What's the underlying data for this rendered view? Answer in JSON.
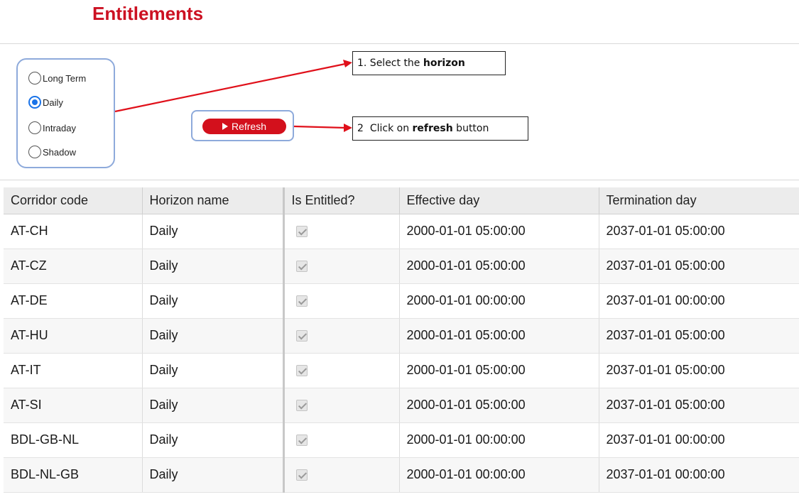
{
  "page": {
    "title": "Entitlements"
  },
  "horizon": {
    "options": [
      {
        "label": "Long Term",
        "selected": false
      },
      {
        "label": "Daily",
        "selected": true
      },
      {
        "label": "Intraday",
        "selected": false
      },
      {
        "label": "Shadow",
        "selected": false
      }
    ]
  },
  "refresh": {
    "label": "Refresh",
    "icon": "play-icon"
  },
  "callouts": {
    "step1": {
      "prefix": "1. Select the ",
      "bold": "horizon"
    },
    "step2": {
      "prefix": "2",
      "middle": "Click on ",
      "bold": "refresh",
      "suffix": " button"
    }
  },
  "colors": {
    "accent": "#cc1122",
    "button": "#d3101c",
    "frame": "#8eaadb",
    "radio": "#1a73e8",
    "arrow": "#e0101a"
  },
  "table": {
    "columns": [
      "Corridor code",
      "Horizon name",
      "Is Entitled?",
      "Effective day",
      "Termination day"
    ],
    "rows": [
      {
        "code": "AT-CH",
        "horizon": "Daily",
        "entitled": true,
        "effective": "2000-01-01 05:00:00",
        "termination": "2037-01-01 05:00:00"
      },
      {
        "code": "AT-CZ",
        "horizon": "Daily",
        "entitled": true,
        "effective": "2000-01-01 05:00:00",
        "termination": "2037-01-01 05:00:00"
      },
      {
        "code": "AT-DE",
        "horizon": "Daily",
        "entitled": true,
        "effective": "2000-01-01 00:00:00",
        "termination": "2037-01-01 00:00:00"
      },
      {
        "code": "AT-HU",
        "horizon": "Daily",
        "entitled": true,
        "effective": "2000-01-01 05:00:00",
        "termination": "2037-01-01 05:00:00"
      },
      {
        "code": "AT-IT",
        "horizon": "Daily",
        "entitled": true,
        "effective": "2000-01-01 05:00:00",
        "termination": "2037-01-01 05:00:00"
      },
      {
        "code": "AT-SI",
        "horizon": "Daily",
        "entitled": true,
        "effective": "2000-01-01 05:00:00",
        "termination": "2037-01-01 05:00:00"
      },
      {
        "code": "BDL-GB-NL",
        "horizon": "Daily",
        "entitled": true,
        "effective": "2000-01-01 00:00:00",
        "termination": "2037-01-01 00:00:00"
      },
      {
        "code": "BDL-NL-GB",
        "horizon": "Daily",
        "entitled": true,
        "effective": "2000-01-01 00:00:00",
        "termination": "2037-01-01 00:00:00"
      }
    ]
  }
}
